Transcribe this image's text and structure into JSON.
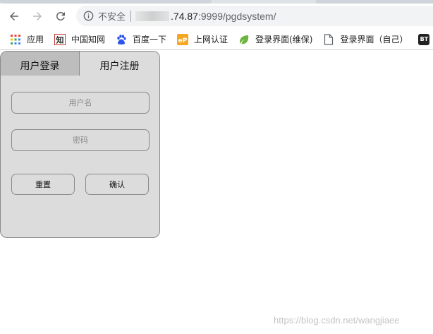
{
  "browser": {
    "security_label": "不安全",
    "url_host": ".74.87",
    "url_path": ":9999/pgdsystem/"
  },
  "bookmarks": [
    {
      "label": "应用",
      "icon": "apps-grid-icon"
    },
    {
      "label": "中国知网",
      "icon": "cnki-icon"
    },
    {
      "label": "百度一下",
      "icon": "baidu-paw-icon"
    },
    {
      "label": "上网认证",
      "icon": "ep-icon"
    },
    {
      "label": "登录界面(维保)",
      "icon": "leaf-icon"
    },
    {
      "label": "登录界面（自己）",
      "icon": "page-icon"
    },
    {
      "label": "BT",
      "icon": "bt-icon"
    }
  ],
  "panel": {
    "tab_login": "用户登录",
    "tab_register": "用户注册",
    "username_placeholder": "用户名",
    "password_placeholder": "密码",
    "reset_label": "重置",
    "confirm_label": "确认"
  },
  "watermark": "https://blog.csdn.net/wangjiaee",
  "colors": {
    "panel_bg": "#dcdcdc",
    "active_tab_bg": "#bdbdbd",
    "border": "#8a8a8a"
  }
}
